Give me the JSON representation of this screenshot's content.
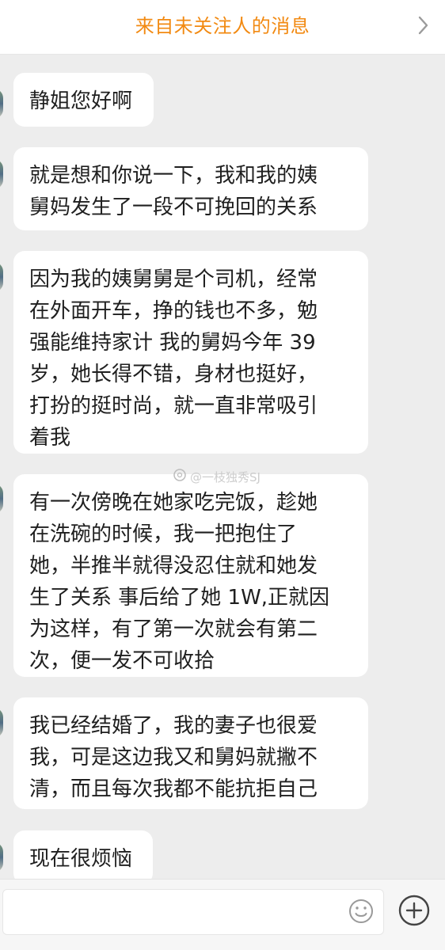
{
  "header": {
    "title": "来自未关注人的消息",
    "chevron_icon": "chevron-right-icon"
  },
  "messages": [
    {
      "text": "静姐您好啊"
    },
    {
      "text": "就是想和你说一下，我和我的姨\n舅妈发生了一段不可挽回的关系"
    },
    {
      "text": "因为我的姨舅舅是个司机，经常\n在外面开车，挣的钱也不多，勉\n强能维持家计 我的舅妈今年 39\n岁，她长得不错，身材也挺好，\n打扮的挺时尚，就一直非常吸引\n着我"
    },
    {
      "text": "有一次傍晚在她家吃完饭，趁她\n在洗碗的时候，我一把抱住了\n她，半推半就得没忍住就和她发\n生了关系 事后给了她 1W,正就因\n为这样，有了第一次就会有第二\n次，便一发不可收拾"
    },
    {
      "text": "我已经结婚了，我的妻子也很爱\n我，可是这边我又和舅妈就撇不\n清，而且每次我都不能抗拒自己"
    },
    {
      "text": "现在很烦恼"
    }
  ],
  "watermark": {
    "text": "@一枝独秀SJ",
    "icon": "weibo-icon"
  },
  "composer": {
    "input_value": "",
    "emoji_icon": "emoji-icon",
    "plus_icon": "plus-icon"
  },
  "colors": {
    "accent": "#f28a12",
    "background": "#ededed",
    "bubble": "#ffffff",
    "text": "#1f1f1f"
  }
}
